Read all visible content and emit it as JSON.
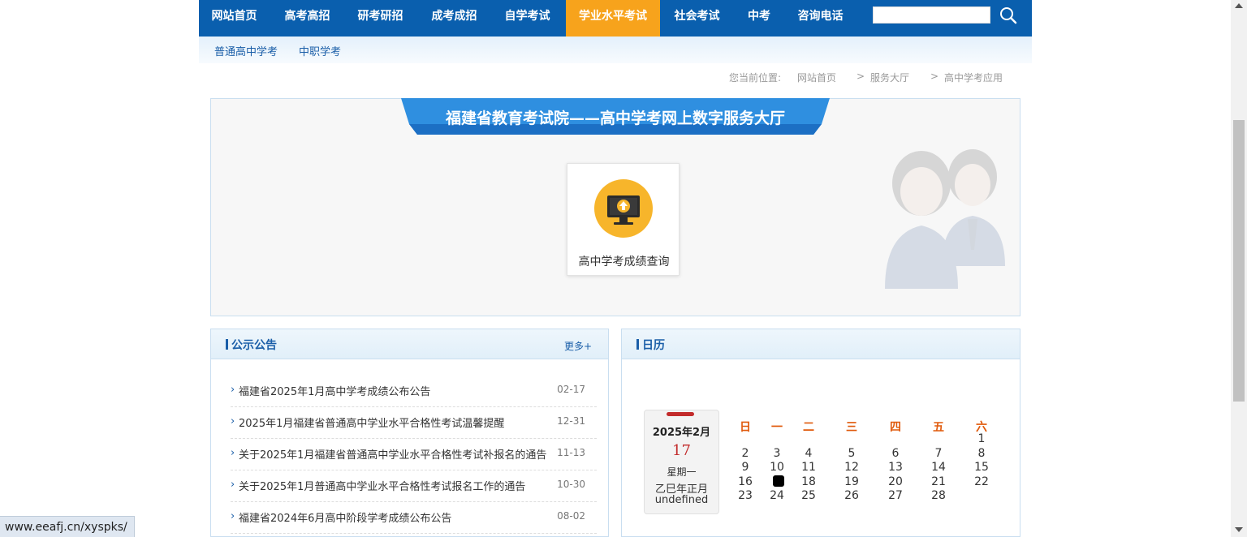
{
  "top_nav": {
    "items": [
      {
        "label": "网站首页"
      },
      {
        "label": "高考高招"
      },
      {
        "label": "研考研招"
      },
      {
        "label": "成考成招"
      },
      {
        "label": "自学考试"
      },
      {
        "label": "学业水平考试",
        "active": true
      },
      {
        "label": "社会考试"
      },
      {
        "label": "中考"
      },
      {
        "label": "咨询电话"
      }
    ],
    "search_value": "",
    "search_icon": "search-icon",
    "colors": {
      "bar": "#0a5fae",
      "active": "#f7a31c"
    }
  },
  "sub_nav": {
    "items": [
      {
        "label": "普通高中学考"
      },
      {
        "label": "中职学考"
      }
    ]
  },
  "breadcrumb": {
    "prefix": "您当前位置:",
    "items": [
      {
        "label": "网站首页"
      },
      {
        "label": "服务大厅"
      },
      {
        "label": "高中学考应用"
      }
    ],
    "separator": ">"
  },
  "hall": {
    "title": "福建省教育考试院——高中学考网上数字服务大厅",
    "services": [
      {
        "label": "高中学考成绩查询",
        "icon": "monitor-upload-icon"
      }
    ],
    "decoration_icon": "customer-service-mascots-icon"
  },
  "announcements": {
    "title": "公示公告",
    "more_label": "更多+",
    "items": [
      {
        "title": "福建省2025年1月高中学考成绩公布公告",
        "date": "02-17"
      },
      {
        "title": "2025年1月福建省普通高中学业水平合格性考试温馨提醒",
        "date": "12-31"
      },
      {
        "title": "关于2025年1月福建省普通高中学业水平合格性考试补报名的通告",
        "date": "11-13"
      },
      {
        "title": "关于2025年1月普通高中学业水平合格性考试报名工作的通告",
        "date": "10-30"
      },
      {
        "title": "福建省2024年6月高中阶段学考成绩公布公告",
        "date": "08-02"
      }
    ]
  },
  "calendar": {
    "title": "日历",
    "month_label": "2025年2月",
    "day": "17",
    "weekday": "星期一",
    "lunar": "乙巳年正月",
    "extra": "undefined",
    "week_headers": [
      "日",
      "一",
      "二",
      "三",
      "四",
      "五",
      "六"
    ],
    "weeks": [
      [
        "",
        "",
        "",
        "",
        "",
        "",
        "1"
      ],
      [
        "2",
        "3",
        "4",
        "5",
        "6",
        "7",
        "8"
      ],
      [
        "9",
        "10",
        "11",
        "12",
        "13",
        "14",
        "15"
      ],
      [
        "16",
        "17",
        "18",
        "19",
        "20",
        "21",
        "22"
      ],
      [
        "23",
        "24",
        "25",
        "26",
        "27",
        "28",
        ""
      ]
    ],
    "today": "17"
  },
  "status_bar": {
    "url": "www.eeafj.cn/xyspks/"
  }
}
